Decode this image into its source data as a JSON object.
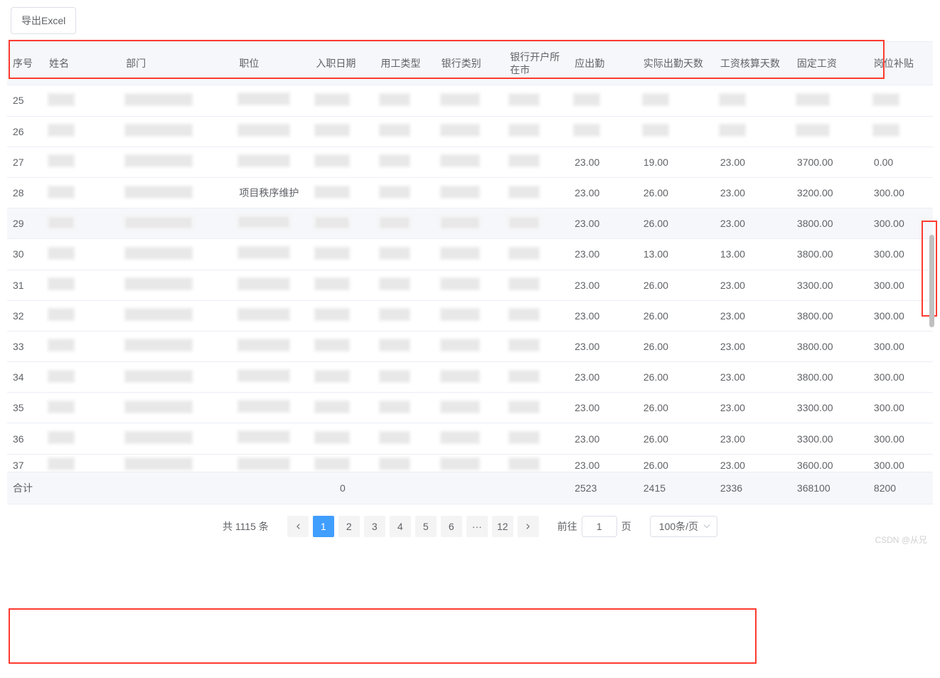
{
  "buttons": {
    "export_excel": "导出Excel"
  },
  "columns": {
    "index": "序号",
    "name": "姓名",
    "department": "部门",
    "position": "职位",
    "hire_date": "入职日期",
    "emp_type": "用工类型",
    "bank_type": "银行类别",
    "bank_city": "银行开户所在市",
    "should_attend": "应出勤",
    "actual_attend": "实际出勤天数",
    "salary_days": "工资核算天数",
    "fixed_salary": "固定工资",
    "post_subsidy": "岗位补贴"
  },
  "rows": [
    {
      "idx": "25"
    },
    {
      "idx": "26"
    },
    {
      "idx": "27",
      "should": "23.00",
      "actual": "19.00",
      "calc": "23.00",
      "fixed": "3700.00",
      "sub": "0.00"
    },
    {
      "idx": "28",
      "position": "项目秩序维护",
      "should": "23.00",
      "actual": "26.00",
      "calc": "23.00",
      "fixed": "3200.00",
      "sub": "300.00"
    },
    {
      "idx": "29",
      "should": "23.00",
      "actual": "26.00",
      "calc": "23.00",
      "fixed": "3800.00",
      "sub": "300.00",
      "hover": true
    },
    {
      "idx": "30",
      "should": "23.00",
      "actual": "13.00",
      "calc": "13.00",
      "fixed": "3800.00",
      "sub": "300.00"
    },
    {
      "idx": "31",
      "should": "23.00",
      "actual": "26.00",
      "calc": "23.00",
      "fixed": "3300.00",
      "sub": "300.00"
    },
    {
      "idx": "32",
      "should": "23.00",
      "actual": "26.00",
      "calc": "23.00",
      "fixed": "3800.00",
      "sub": "300.00"
    },
    {
      "idx": "33",
      "should": "23.00",
      "actual": "26.00",
      "calc": "23.00",
      "fixed": "3800.00",
      "sub": "300.00"
    },
    {
      "idx": "34",
      "should": "23.00",
      "actual": "26.00",
      "calc": "23.00",
      "fixed": "3800.00",
      "sub": "300.00"
    },
    {
      "idx": "35",
      "should": "23.00",
      "actual": "26.00",
      "calc": "23.00",
      "fixed": "3300.00",
      "sub": "300.00"
    },
    {
      "idx": "36",
      "should": "23.00",
      "actual": "26.00",
      "calc": "23.00",
      "fixed": "3300.00",
      "sub": "300.00"
    },
    {
      "idx": "37",
      "should": "23.00",
      "actual": "26.00",
      "calc": "23.00",
      "fixed": "3600.00",
      "sub": "300.00",
      "cut": true
    }
  ],
  "totals": {
    "label": "合计",
    "date": "0",
    "should": "2523",
    "actual": "2415",
    "calc": "2336",
    "fixed": "368100",
    "sub": "8200"
  },
  "pagination": {
    "total_label": "共 1115 条",
    "pages": [
      "1",
      "2",
      "3",
      "4",
      "5",
      "6",
      "···",
      "12"
    ],
    "active_page": "1",
    "goto_label": "前往",
    "goto_value": "1",
    "goto_suffix": "页",
    "size_label": "100条/页"
  },
  "watermark": "CSDN @从兄"
}
